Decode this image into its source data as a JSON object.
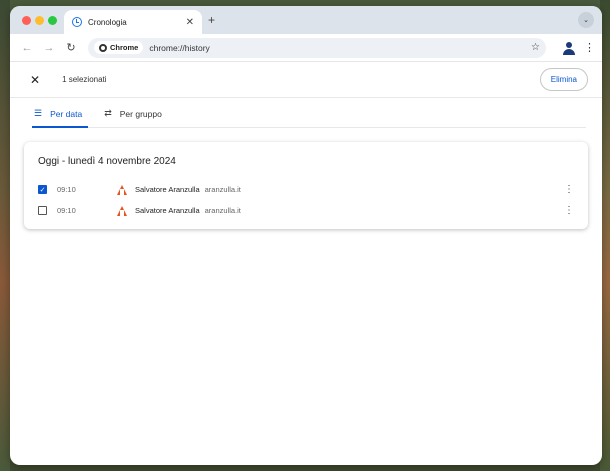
{
  "browser": {
    "tab_title": "Cronologia",
    "tab_close": "✕",
    "new_tab": "+",
    "tab_menu": "⌄",
    "chip_label": "Chrome",
    "url": "chrome://history",
    "star": "☆",
    "kebab": "⋮",
    "back": "←",
    "forward": "→",
    "reload": "↻"
  },
  "selection": {
    "close": "✕",
    "text": "1 selezionati",
    "delete_label": "Elimina"
  },
  "view_tabs": [
    {
      "label": "Per data",
      "icon": "☰",
      "active": true
    },
    {
      "label": "Per gruppo",
      "icon": "⇄",
      "active": false
    }
  ],
  "day": {
    "title": "Oggi - lunedì 4 novembre 2024",
    "entries": [
      {
        "checked": true,
        "check": "✓",
        "time": "09:10",
        "title": "Salvatore Aranzulla",
        "domain": "aranzulla.it",
        "menu": "⋮"
      },
      {
        "checked": false,
        "check": "",
        "time": "09:10",
        "title": "Salvatore Aranzulla",
        "domain": "aranzulla.it",
        "menu": "⋮"
      }
    ]
  },
  "colors": {
    "accent": "#0b57d0",
    "tabstrip": "#dde3ea",
    "favicon": "#e8541e"
  }
}
